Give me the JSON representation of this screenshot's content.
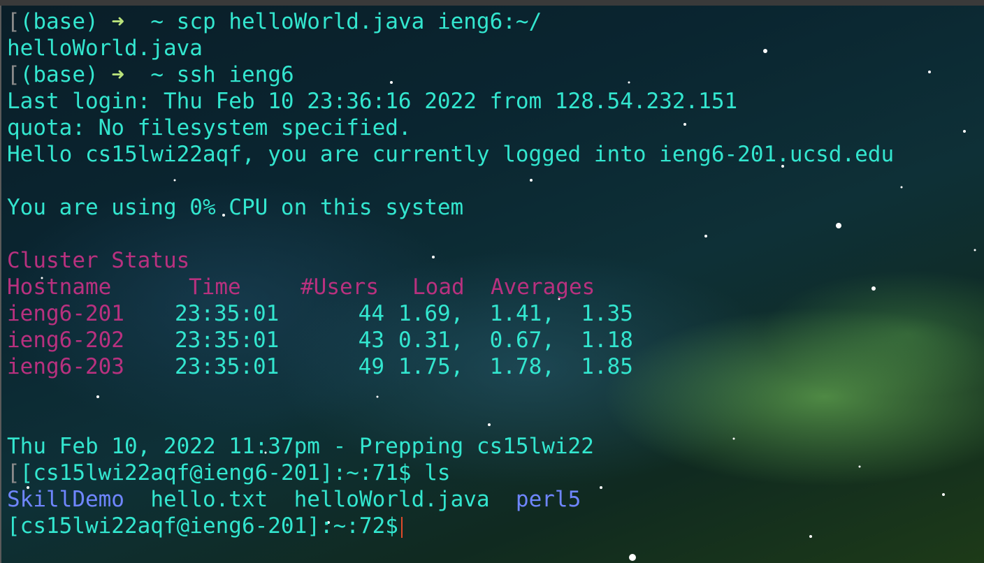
{
  "session": [
    {
      "bracket": "[",
      "prompt": "(base)",
      "arrow": "➜",
      "tilde": "~",
      "command": "scp helloWorld.java ieng6:~/"
    },
    {
      "output": "helloWorld.java"
    },
    {
      "bracket": "[",
      "prompt": "(base)",
      "arrow": "➜",
      "tilde": "~",
      "command": "ssh ieng6"
    }
  ],
  "login": {
    "last_login": "Last login: Thu Feb 10 23:36:16 2022 from 128.54.232.151",
    "quota": "quota: No filesystem specified.",
    "hello": "Hello cs15lwi22aqf, you are currently logged into ieng6-201.ucsd.edu",
    "cpu": "You are using 0% CPU on this system"
  },
  "cluster": {
    "title": "Cluster Status",
    "headers": {
      "hostname": "Hostname",
      "time": "Time",
      "users": "#Users",
      "load": "Load  Averages"
    },
    "rows": [
      {
        "host": "ieng6-201",
        "time": "23:35:01",
        "users": "44",
        "load": "1.69,  1.41,  1.35"
      },
      {
        "host": "ieng6-202",
        "time": "23:35:01",
        "users": "43",
        "load": "0.31,  0.67,  1.18"
      },
      {
        "host": "ieng6-203",
        "time": "23:35:01",
        "users": "49",
        "load": "1.75,  1.78,  1.85"
      }
    ]
  },
  "prep": "Thu Feb 10, 2022 11:37pm - Prepping cs15lwi22",
  "prompt1": {
    "bracket": "[",
    "text": "[cs15lwi22aqf@ieng6-201]:~:71$",
    "command": "ls"
  },
  "ls_output": {
    "dir1": "SkillDemo",
    "file1": "hello.txt",
    "file2": "helloWorld.java",
    "dir2": "perl5"
  },
  "prompt2": {
    "text": "[cs15lwi22aqf@ieng6-201]:~:72$"
  },
  "colors": {
    "text": "#33e6cf",
    "arrow": "#b9e27a",
    "heading": "#b8317f",
    "directory": "#6f86ff",
    "cursor": "#e04a2a"
  }
}
